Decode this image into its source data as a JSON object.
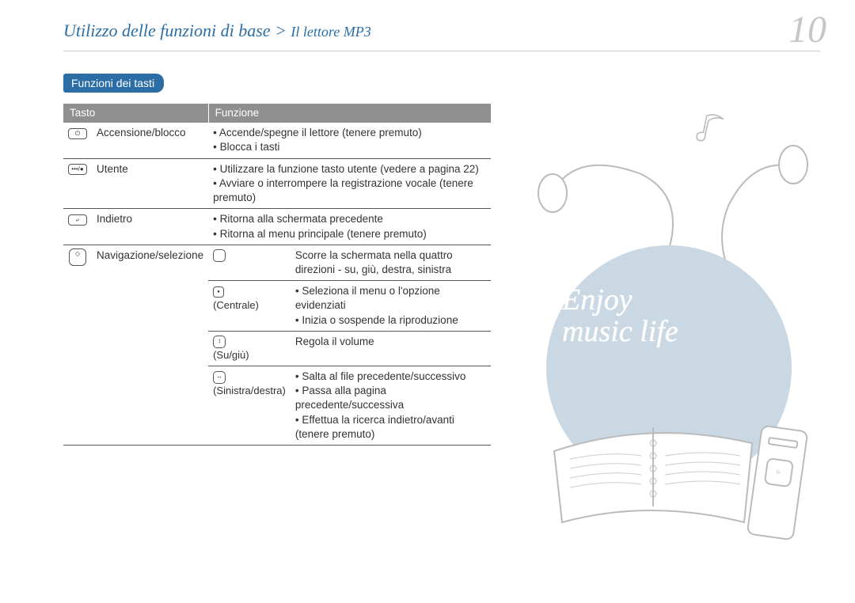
{
  "header": {
    "breadcrumb_main": "Utilizzo delle funzioni di base",
    "breadcrumb_separator": " > ",
    "breadcrumb_sub": "Il lettore MP3",
    "page_number": "10"
  },
  "section_title": "Funzioni dei tasti",
  "table_headers": {
    "key": "Tasto",
    "function": "Funzione"
  },
  "rows": [
    {
      "icon": "power-lock-icon",
      "key_label": "Accensione/blocco",
      "functions": [
        "Accende/spegne il lettore (tenere premuto)",
        "Blocca i tasti"
      ]
    },
    {
      "icon": "user-icon",
      "key_label": "Utente",
      "functions": [
        "Utilizzare la funzione tasto utente (vedere a pagina 22)",
        "Avviare o interrompere la registrazione vocale (tenere premuto)"
      ]
    },
    {
      "icon": "back-icon",
      "key_label": "Indietro",
      "functions": [
        "Ritorna alla schermata precedente",
        "Ritorna al menu principale (tenere premuto)"
      ]
    }
  ],
  "nav_row": {
    "icon": "dpad-icon",
    "key_label": "Navigazione/selezione",
    "subrows": [
      {
        "sub_icon": "dpad-outline-icon",
        "sub_label": "",
        "text": "Scorre la schermata nella quattro direzioni - su, giù, destra, sinistra"
      },
      {
        "sub_icon": "center-icon",
        "sub_label": "(Centrale)",
        "functions": [
          "Seleziona il menu o l'opzione evidenziati",
          "Inizia o sospende la riproduzione"
        ]
      },
      {
        "sub_icon": "updown-icon",
        "sub_label": "(Su/giù)",
        "text": "Regola il volume"
      },
      {
        "sub_icon": "leftright-icon",
        "sub_label": "(Sinistra/destra)",
        "functions": [
          "Salta al file precedente/successivo",
          "Passa alla pagina precedente/successiva",
          "Effettua la ricerca indietro/avanti (tenere premuto)"
        ]
      }
    ]
  },
  "illustration": {
    "tagline_line1": "Enjoy",
    "tagline_line2": "music life"
  }
}
